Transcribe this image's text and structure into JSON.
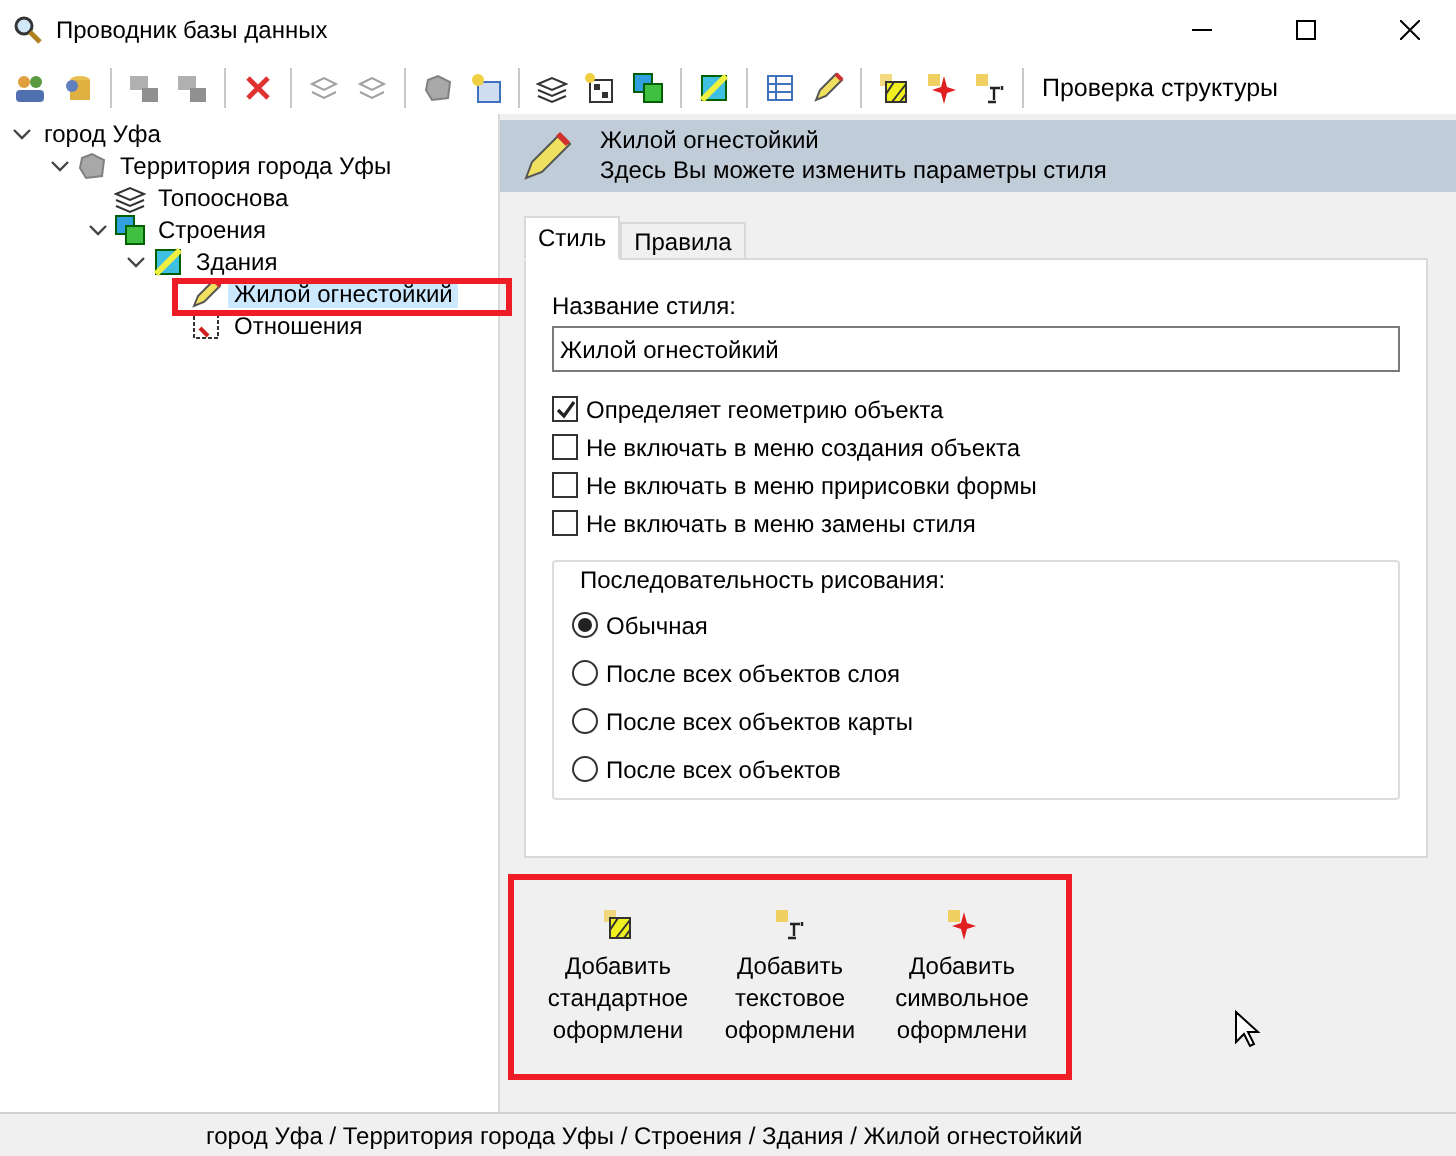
{
  "window": {
    "title": "Проводник базы данных"
  },
  "toolbar": {
    "check_button": "Проверка структуры"
  },
  "tree": [
    {
      "label": "город Уфа",
      "expanded": true,
      "selected": false,
      "children": [
        {
          "label": "Территория города Уфы",
          "kind": "region",
          "expanded": true,
          "selected": false,
          "children": [
            {
              "label": "Топооснова",
              "kind": "layers",
              "selected": false
            },
            {
              "label": "Строения",
              "kind": "group",
              "expanded": true,
              "selected": false,
              "children": [
                {
                  "label": "Здания",
                  "kind": "layer",
                  "expanded": true,
                  "selected": false,
                  "children": [
                    {
                      "label": "Жилой огнестойкий",
                      "kind": "style",
                      "selected": true
                    },
                    {
                      "label": "Отношения",
                      "kind": "relation",
                      "selected": false
                    }
                  ]
                }
              ]
            }
          ]
        }
      ]
    }
  ],
  "header": {
    "title": "Жилой огнестойкий",
    "subtitle": "Здесь Вы можете изменить параметры стиля"
  },
  "tabs": [
    {
      "label": "Стиль",
      "selected": true
    },
    {
      "label": "Правила",
      "selected": false
    }
  ],
  "style_name": {
    "label": "Название стиля:",
    "value": "Жилой огнестойкий"
  },
  "checkboxes": [
    {
      "label": "Определяет геометрию объекта",
      "checked": true
    },
    {
      "label": "Не включать в меню создания объекта",
      "checked": false
    },
    {
      "label": "Не включать в меню пририсовки формы",
      "checked": false
    },
    {
      "label": "Не включать в меню замены стиля",
      "checked": false
    }
  ],
  "draw_order": {
    "title": "Последовательность рисования:",
    "options": [
      {
        "label": "Обычная",
        "selected": true
      },
      {
        "label": "После всех объектов слоя",
        "selected": false
      },
      {
        "label": "После всех объектов карты",
        "selected": false
      },
      {
        "label": "После всех объектов",
        "selected": false
      }
    ]
  },
  "add_buttons": [
    {
      "kind": "standard",
      "lines": [
        "Добавить",
        "стандартное",
        "оформлени"
      ]
    },
    {
      "kind": "text",
      "lines": [
        "Добавить",
        "текстовое",
        "оформлени"
      ]
    },
    {
      "kind": "symbol",
      "lines": [
        "Добавить",
        "символьное",
        "оформлени"
      ]
    }
  ],
  "status_bar": {
    "path": "город Уфа / Территория города Уфы / Строения / Здания / Жилой огнестойкий"
  }
}
